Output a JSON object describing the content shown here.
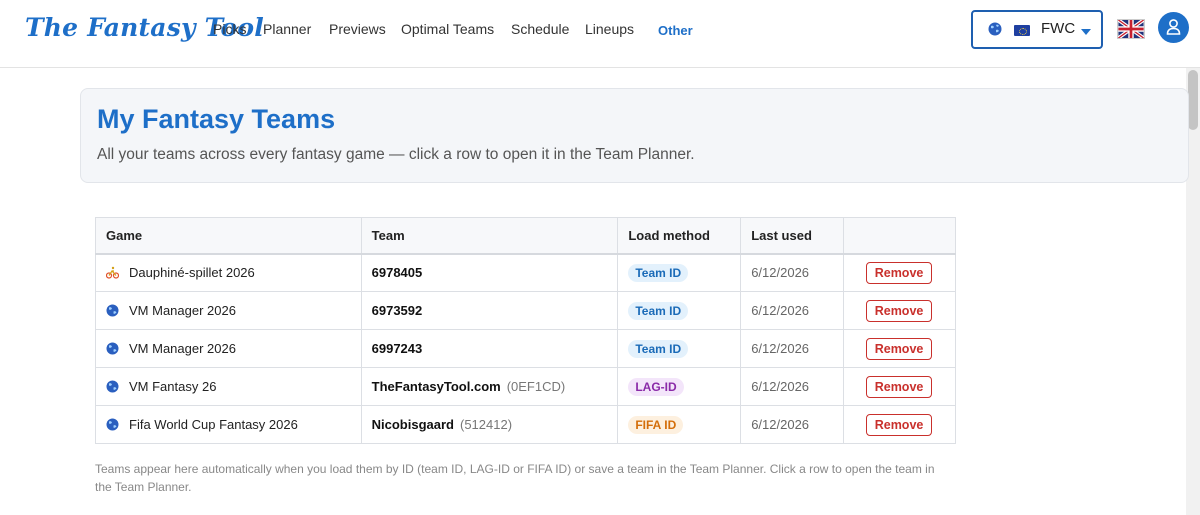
{
  "header": {
    "logo": "The Fantasy Tool",
    "nav": [
      "Picks",
      "Planner",
      "Previews",
      "Optimal Teams",
      "Schedule",
      "Lineups"
    ],
    "nav_other": "Other",
    "game_selector": "FWC",
    "icons": {
      "globe": "globe-icon",
      "eu_flag": "eu-flag-icon",
      "caret": "caret-down-icon",
      "uk_flag": "uk-flag-icon",
      "avatar": "user-icon"
    }
  },
  "hero": {
    "title": "My Fantasy Teams",
    "subtitle": "All your teams across every fantasy game — click a row to open it in the Team Planner."
  },
  "table": {
    "columns": [
      "Game",
      "Team",
      "Load method",
      "Last used",
      ""
    ],
    "rows": [
      {
        "game": "Dauphiné-spillet 2026",
        "icon": "cycling-icon",
        "team": "6978405",
        "team_sub": "",
        "method": "Team ID",
        "method_type": "team",
        "last_used": "6/12/2026",
        "action": "Remove"
      },
      {
        "game": "VM Manager 2026",
        "icon": "globe-icon",
        "team": "6973592",
        "team_sub": "",
        "method": "Team ID",
        "method_type": "team",
        "last_used": "6/12/2026",
        "action": "Remove"
      },
      {
        "game": "VM Manager 2026",
        "icon": "globe-icon",
        "team": "6997243",
        "team_sub": "",
        "method": "Team ID",
        "method_type": "team",
        "last_used": "6/12/2026",
        "action": "Remove"
      },
      {
        "game": "VM Fantasy 26",
        "icon": "globe-icon",
        "team": "TheFantasyTool.com",
        "team_sub": "(0EF1CD)",
        "method": "LAG-ID",
        "method_type": "lag",
        "last_used": "6/12/2026",
        "action": "Remove"
      },
      {
        "game": "Fifa World Cup Fantasy 2026",
        "icon": "globe-icon",
        "team": "Nicobisgaard",
        "team_sub": "(512412)",
        "method": "FIFA ID",
        "method_type": "fifa",
        "last_used": "6/12/2026",
        "action": "Remove"
      }
    ]
  },
  "footer": {
    "note": "Teams appear here automatically when you load them by ID (team ID, LAG-ID or FIFA ID) or save a team in the Team Planner. Click a row to open the team in the Team Planner."
  },
  "colors": {
    "brand": "#1e6fc8",
    "remove": "#c9302c",
    "badge_team_bg": "#e3f1fc",
    "badge_lag_bg": "#f3e5fa",
    "badge_fifa_bg": "#fdf0df"
  }
}
